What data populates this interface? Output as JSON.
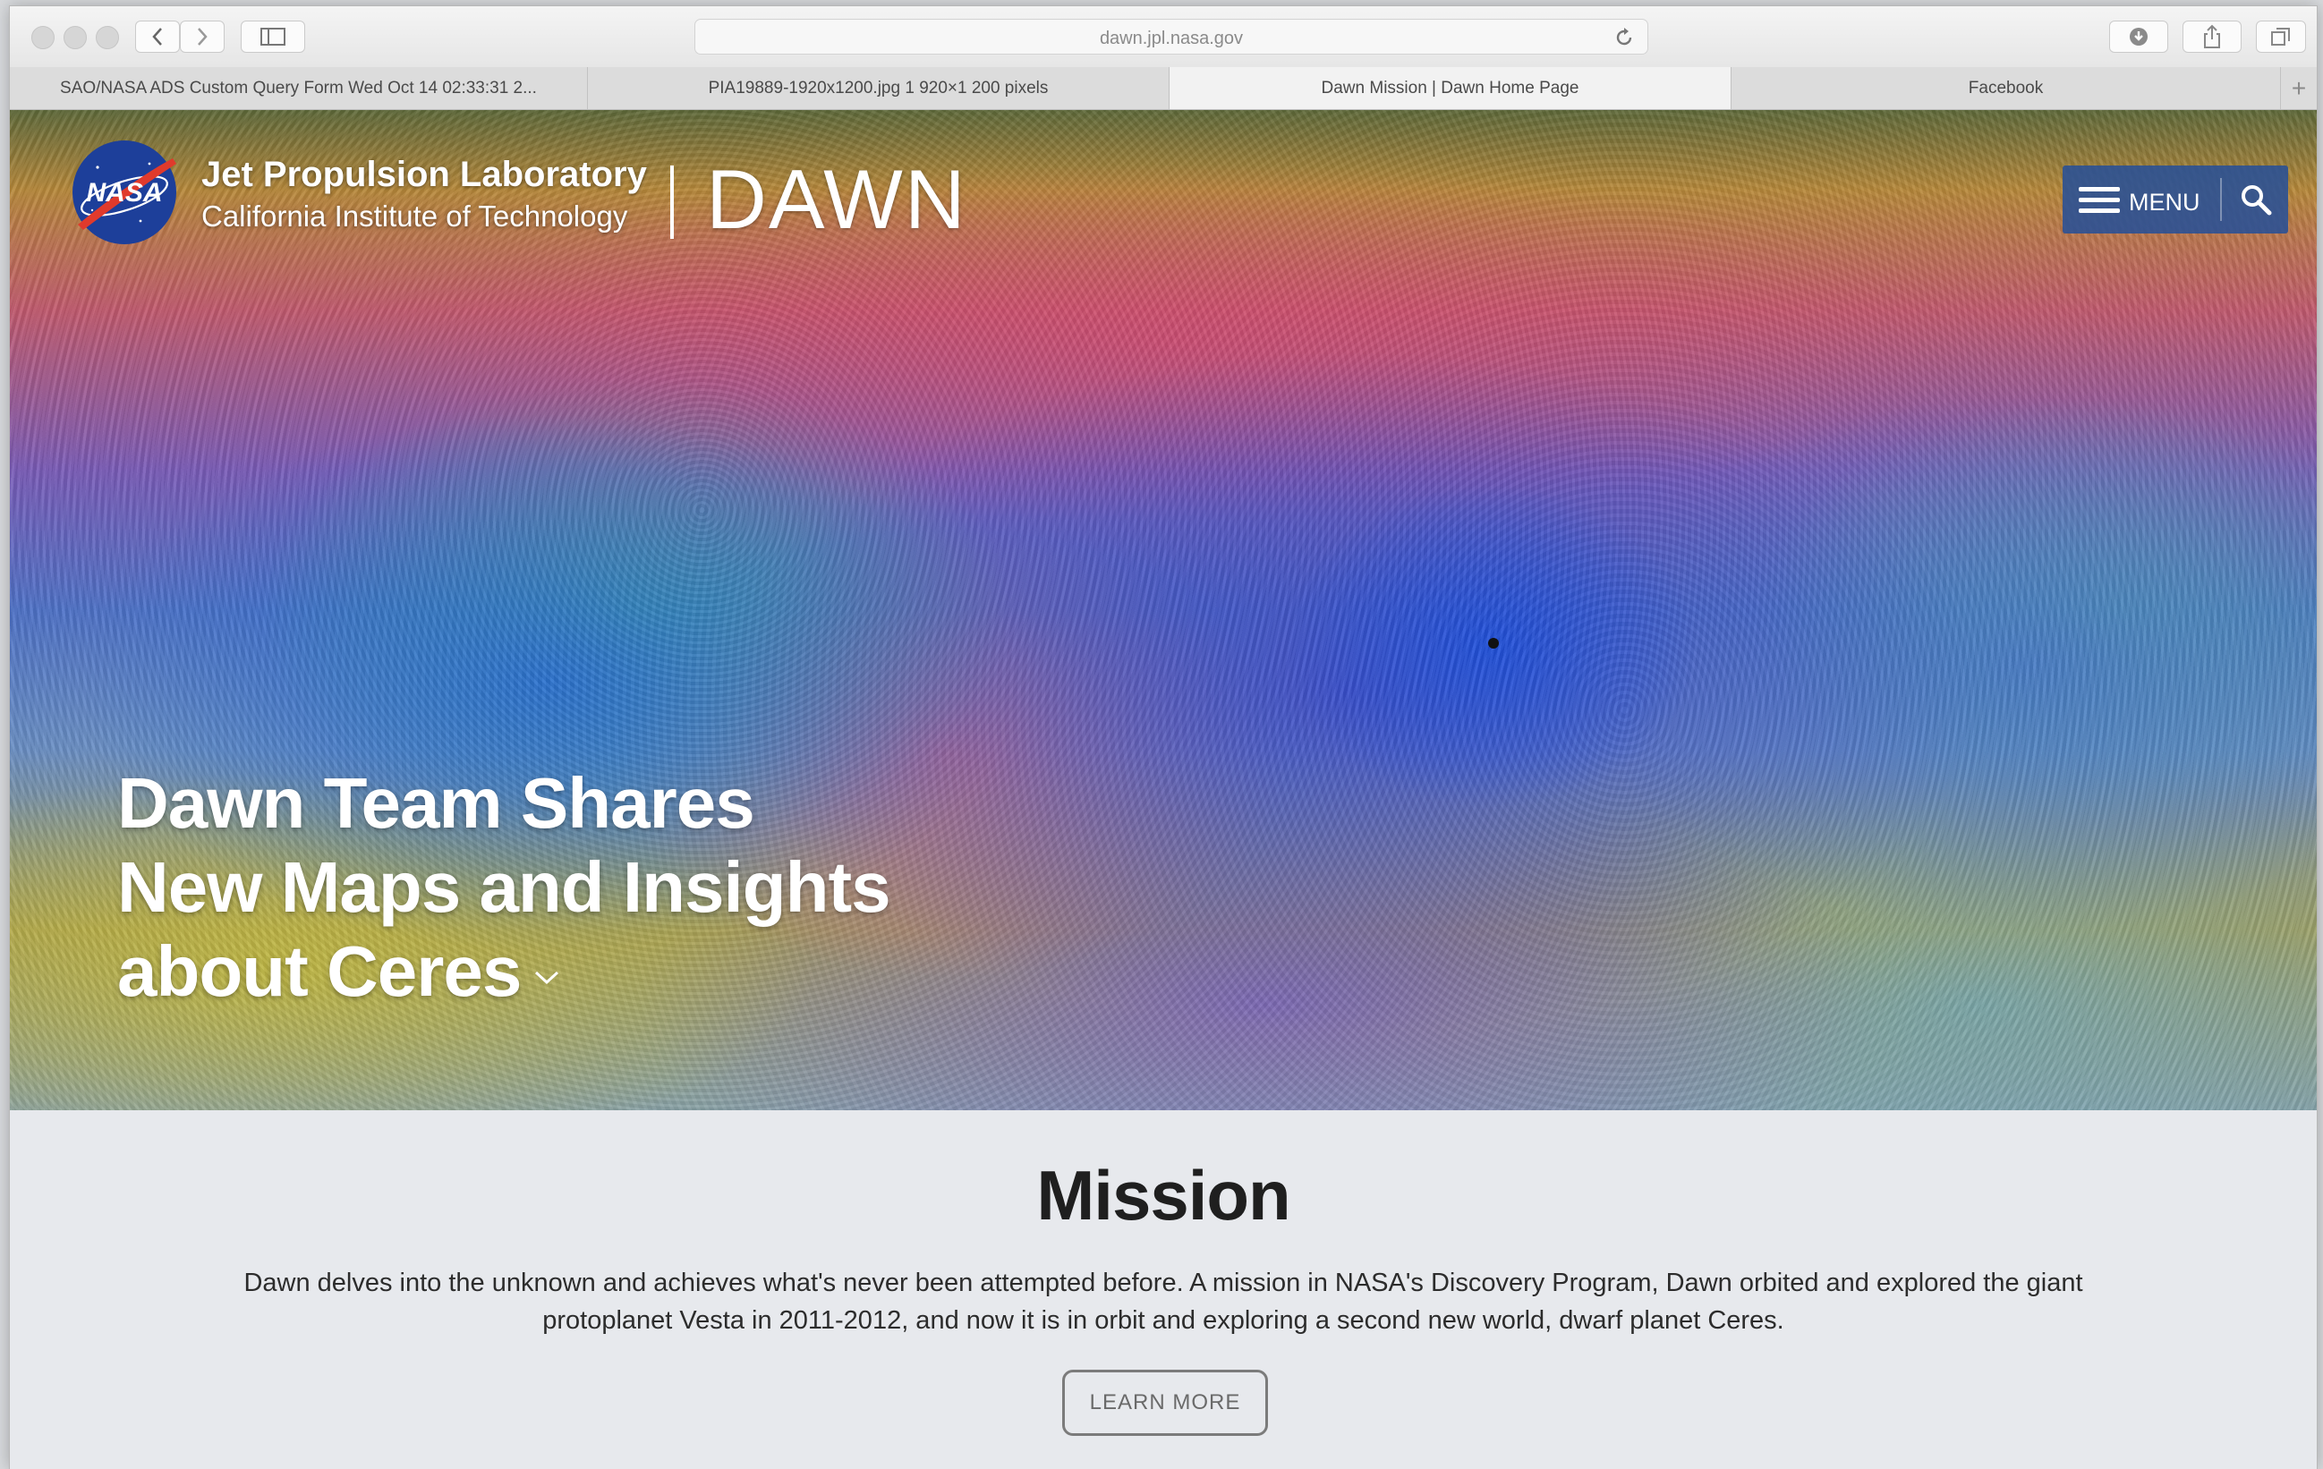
{
  "browser": {
    "address": "dawn.jpl.nasa.gov",
    "tabs": [
      {
        "label": "SAO/NASA ADS Custom Query Form Wed Oct 14 02:33:31 2..."
      },
      {
        "label": "PIA19889-1920x1200.jpg 1 920×1 200 pixels"
      },
      {
        "label": "Dawn Mission | Dawn Home Page"
      },
      {
        "label": "Facebook"
      }
    ],
    "new_tab": "+"
  },
  "header": {
    "nasa_logo_text": "NASA",
    "lab_name": "Jet Propulsion Laboratory",
    "institute": "California Institute of Technology",
    "mission_word": "DAWN",
    "menu_label": "MENU"
  },
  "hero": {
    "headline_lines": [
      "Dawn Team Shares",
      "New Maps and Insights",
      "about Ceres"
    ]
  },
  "mission": {
    "title": "Mission",
    "text": "Dawn delves into the unknown and achieves what's never been attempted before. A mission in NASA's Discovery Program, Dawn orbited and explored the giant protoplanet Vesta in 2011-2012, and now it is in orbit and exploring a second new world, dwarf planet Ceres.",
    "button_label": "LEARN MORE"
  },
  "icons": {
    "back": "chevron-left-icon",
    "forward": "chevron-right-icon",
    "sidebar": "sidebar-icon",
    "reload": "reload-icon",
    "download": "download-icon",
    "share": "share-icon",
    "tabs": "tabs-overview-icon",
    "menu": "hamburger-icon",
    "search": "search-icon"
  },
  "colors": {
    "menu_bg": "#2a5096",
    "mission_bg": "#e7e9ed"
  }
}
